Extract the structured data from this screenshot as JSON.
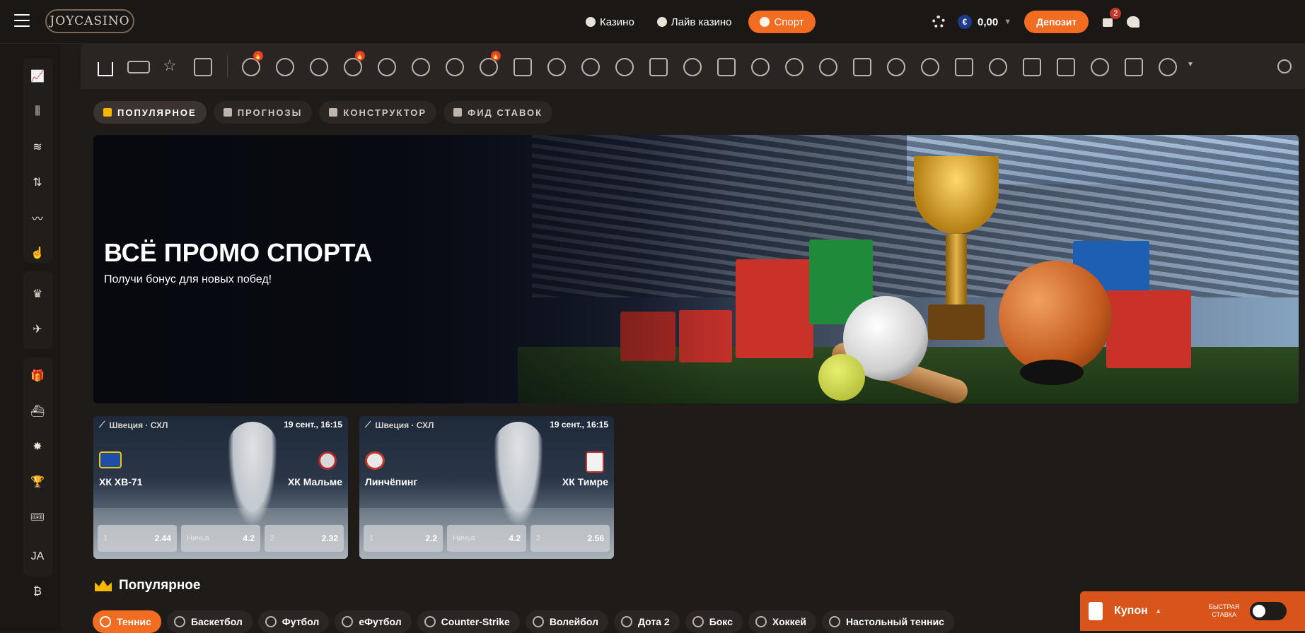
{
  "header": {
    "logo": "JOYCASINO",
    "nav": [
      {
        "label": "Казино"
      },
      {
        "label": "Лайв казино"
      },
      {
        "label": "Спорт",
        "active": true
      }
    ],
    "balance": "0,00",
    "currency_symbol": "€",
    "deposit_label": "Депозит",
    "gift_badge": "2"
  },
  "sports_bar": {
    "live_badges": [
      "🔥",
      "🔥",
      "🔥"
    ]
  },
  "tabs": [
    {
      "label": "ПОПУЛЯРНОЕ",
      "active": true
    },
    {
      "label": "ПРОГНОЗЫ"
    },
    {
      "label": "КОНСТРУКТОР"
    },
    {
      "label": "ФИД СТАВОК"
    }
  ],
  "banner": {
    "title": "ВСЁ ПРОМО СПОРТА",
    "subtitle": "Получи бонус для новых побед!"
  },
  "matches": [
    {
      "league": "Швеция · СХЛ",
      "datetime": "19 сент., 16:15",
      "home": "ХК ХВ-71",
      "away": "ХК Мальме",
      "odds": [
        {
          "label": "1",
          "value": "2.44"
        },
        {
          "label": "Ничья",
          "value": "4.2"
        },
        {
          "label": "2",
          "value": "2.32"
        }
      ]
    },
    {
      "league": "Швеция · СХЛ",
      "datetime": "19 сент., 16:15",
      "home": "Линчёпинг",
      "away": "ХК Тимре",
      "odds": [
        {
          "label": "1",
          "value": "2.2"
        },
        {
          "label": "Ничья",
          "value": "4.2"
        },
        {
          "label": "2",
          "value": "2.56"
        }
      ]
    }
  ],
  "popular": {
    "title": "Популярное",
    "chips": [
      {
        "label": "Теннис",
        "active": true
      },
      {
        "label": "Баскетбол"
      },
      {
        "label": "Футбол"
      },
      {
        "label": "eФутбол"
      },
      {
        "label": "Counter-Strike"
      },
      {
        "label": "Волейбол"
      },
      {
        "label": "Дота 2"
      },
      {
        "label": "Бокс"
      },
      {
        "label": "Хоккей"
      },
      {
        "label": "Настольный теннис"
      }
    ]
  },
  "coupon": {
    "label": "Купон",
    "quick_bet_line1": "БЫСТРАЯ",
    "quick_bet_line2": "СТАВКА"
  },
  "colors": {
    "accent": "#f26d21",
    "background": "#1f1b18",
    "gold": "#f5b700"
  }
}
